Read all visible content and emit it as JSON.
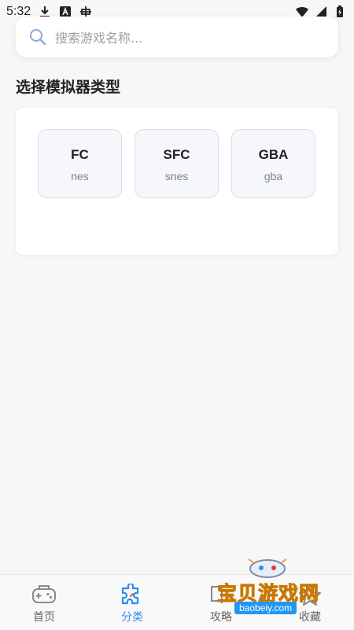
{
  "status_bar": {
    "time": "5:32"
  },
  "search": {
    "placeholder": "搜索游戏名称..."
  },
  "section": {
    "title": "选择模拟器类型"
  },
  "emulators": [
    {
      "name": "FC",
      "sub": "nes"
    },
    {
      "name": "SFC",
      "sub": "snes"
    },
    {
      "name": "GBA",
      "sub": "gba"
    }
  ],
  "tabs": [
    {
      "label": "首页",
      "icon": "gamepad-icon"
    },
    {
      "label": "分类",
      "icon": "puzzle-icon",
      "active": true
    },
    {
      "label": "攻略",
      "icon": "book-icon"
    },
    {
      "label": "收藏",
      "icon": "star-icon"
    }
  ],
  "watermark": {
    "text": "宝贝游戏网",
    "url": "baobeiy.com"
  },
  "colors": {
    "accent": "#2d8cf0",
    "background": "#f7f7f8"
  }
}
